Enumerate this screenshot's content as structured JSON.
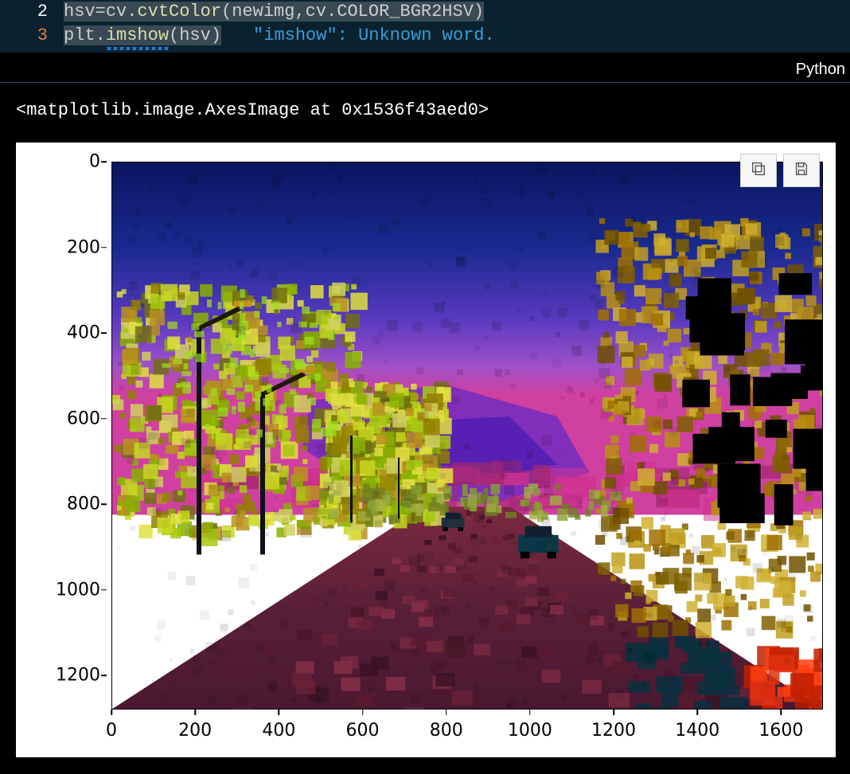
{
  "code": {
    "line2": {
      "number": "2",
      "text_a": "hsv",
      "text_b": "=",
      "text_c": "cv",
      "text_d": ".",
      "text_e": "cvtColor",
      "text_f": "(",
      "text_g": "newimg",
      "text_h": ",",
      "text_i": "cv",
      "text_j": ".",
      "text_k": "COLOR_BGR2HSV",
      "text_l": ")"
    },
    "line3": {
      "number": "3",
      "text_a": "plt",
      "text_b": ".",
      "text_c": "imshow",
      "text_d": "(",
      "text_e": "hsv",
      "text_f": ")"
    },
    "lint_message": "\"imshow\": Unknown word."
  },
  "kernel_label": "Python",
  "output_repr": "<matplotlib.image.AxesImage at 0x1536f43aed0>",
  "toolbar": {
    "copy": "copy",
    "save": "save"
  },
  "chart_data": {
    "type": "image",
    "description": "HSV-converted street scene displayed as RGB (false color): deep blue/purple sky, magenta horizon, yellow-green foliage, dark reddish road, vehicles and streetlights visible.",
    "x_range": [
      0,
      1700
    ],
    "y_range": [
      0,
      1280
    ],
    "y_inverted": true,
    "x_ticks": [
      0,
      200,
      400,
      600,
      800,
      1000,
      1200,
      1400,
      1600
    ],
    "y_ticks": [
      0,
      200,
      400,
      600,
      800,
      1000,
      1200
    ],
    "xlabel": "",
    "ylabel": "",
    "title": ""
  }
}
